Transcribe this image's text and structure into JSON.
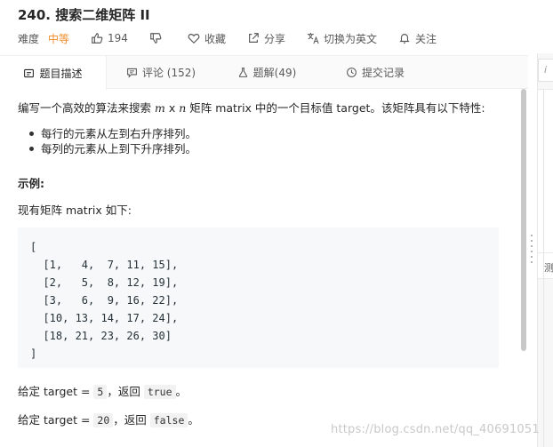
{
  "title": "240. 搜索二维矩阵 II",
  "meta": {
    "difficulty_label": "难度",
    "difficulty_value": "中等",
    "likes": "194",
    "favorite": "收藏",
    "share": "分享",
    "translate": "切换为英文",
    "follow": "关注"
  },
  "tabs": [
    {
      "label": "题目描述"
    },
    {
      "label": "评论 (152)"
    },
    {
      "label": "题解(49)"
    },
    {
      "label": "提交记录"
    }
  ],
  "description": {
    "intro_pre": "编写一个高效的算法来搜索 ",
    "intro_m": "m",
    "intro_x": " x ",
    "intro_n": "n",
    "intro_post": " 矩阵 matrix 中的一个目标值 target。该矩阵具有以下特性:",
    "bullets": [
      "每行的元素从左到右升序排列。",
      "每列的元素从上到下升序排列。"
    ],
    "example_head": "示例:",
    "example_intro": "现有矩阵 matrix 如下:",
    "code": "[\n  [1,   4,  7, 11, 15],\n  [2,   5,  8, 12, 19],\n  [3,   6,  9, 16, 22],\n  [10, 13, 14, 17, 24],\n  [18, 21, 23, 26, 30]\n]",
    "given1_pre": "给定 target = ",
    "given1_val": "5",
    "given1_mid": "，返回 ",
    "given1_ret": "true",
    "given1_end": "。",
    "given2_pre": "给定 target = ",
    "given2_val": "20",
    "given2_mid": "，返回 ",
    "given2_ret": "false",
    "given2_end": "。"
  },
  "right_panel": {
    "box1": "i",
    "box3": "测"
  },
  "watermark": "https://blog.csdn.net/qq_40691051"
}
